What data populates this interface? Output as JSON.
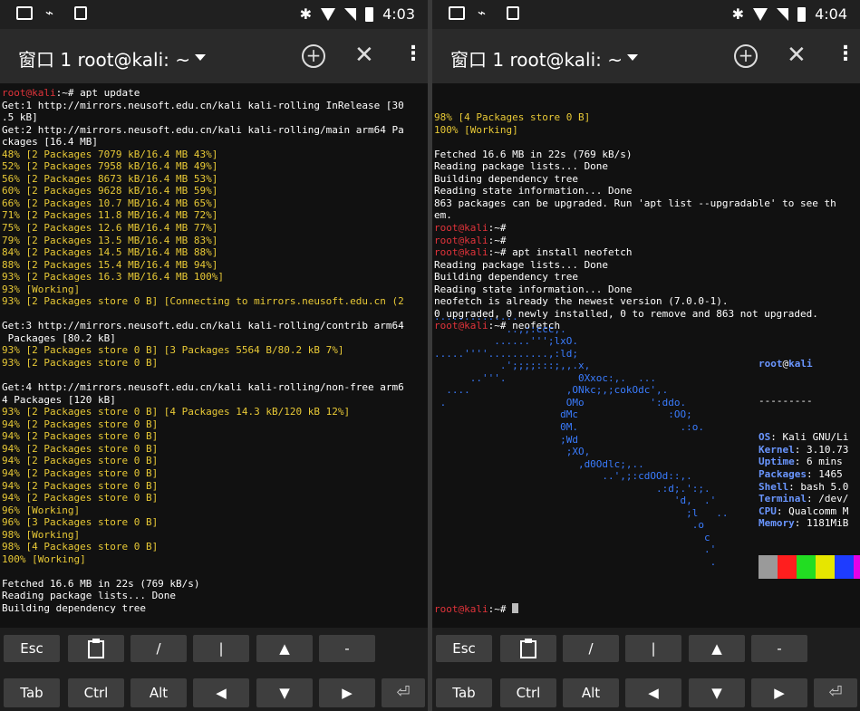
{
  "left": {
    "status": {
      "time": "4:03"
    },
    "appbar": {
      "title": "窗口 1 root@kali: ~"
    },
    "lines": [
      [
        {
          "t": "root@kali",
          "c": "r"
        },
        {
          "t": ":~# apt update"
        }
      ],
      [
        {
          "t": "Get:1 http://mirrors.neusoft.edu.cn/kali kali-rolling InRelease [30"
        }
      ],
      [
        {
          "t": ".5 kB]"
        }
      ],
      [
        {
          "t": "Get:2 http://mirrors.neusoft.edu.cn/kali kali-rolling/main arm64 Pa"
        }
      ],
      [
        {
          "t": "ckages [16.4 MB]"
        }
      ],
      [
        {
          "t": "48% [2 Packages 7079 kB/16.4 MB 43%]",
          "c": "y"
        }
      ],
      [
        {
          "t": "52% [2 Packages 7958 kB/16.4 MB 49%]",
          "c": "y"
        }
      ],
      [
        {
          "t": "56% [2 Packages 8673 kB/16.4 MB 53%]",
          "c": "y"
        }
      ],
      [
        {
          "t": "60% [2 Packages 9628 kB/16.4 MB 59%]",
          "c": "y"
        }
      ],
      [
        {
          "t": "66% [2 Packages 10.7 MB/16.4 MB 65%]",
          "c": "y"
        }
      ],
      [
        {
          "t": "71% [2 Packages 11.8 MB/16.4 MB 72%]",
          "c": "y"
        }
      ],
      [
        {
          "t": "75% [2 Packages 12.6 MB/16.4 MB 77%]",
          "c": "y"
        }
      ],
      [
        {
          "t": "79% [2 Packages 13.5 MB/16.4 MB 83%]",
          "c": "y"
        }
      ],
      [
        {
          "t": "84% [2 Packages 14.5 MB/16.4 MB 88%]",
          "c": "y"
        }
      ],
      [
        {
          "t": "88% [2 Packages 15.4 MB/16.4 MB 94%]",
          "c": "y"
        }
      ],
      [
        {
          "t": "93% [2 Packages 16.3 MB/16.4 MB 100%]",
          "c": "y"
        }
      ],
      [
        {
          "t": "93% [Working]",
          "c": "y"
        }
      ],
      [
        {
          "t": "93% [2 Packages store 0 B] [Connecting to mirrors.neusoft.edu.cn (2",
          "c": "y"
        }
      ],
      [
        {
          "t": ""
        }
      ],
      [
        {
          "t": "Get:3 http://mirrors.neusoft.edu.cn/kali kali-rolling/contrib arm64"
        }
      ],
      [
        {
          "t": " Packages [80.2 kB]"
        }
      ],
      [
        {
          "t": "93% [2 Packages store 0 B] [3 Packages 5564 B/80.2 kB 7%]",
          "c": "y"
        }
      ],
      [
        {
          "t": "93% [2 Packages store 0 B]",
          "c": "y"
        }
      ],
      [
        {
          "t": ""
        }
      ],
      [
        {
          "t": "Get:4 http://mirrors.neusoft.edu.cn/kali kali-rolling/non-free arm6"
        }
      ],
      [
        {
          "t": "4 Packages [120 kB]"
        }
      ],
      [
        {
          "t": "93% [2 Packages store 0 B] [4 Packages 14.3 kB/120 kB 12%]",
          "c": "y"
        }
      ],
      [
        {
          "t": "94% [2 Packages store 0 B]",
          "c": "y"
        }
      ],
      [
        {
          "t": "94% [2 Packages store 0 B]",
          "c": "y"
        }
      ],
      [
        {
          "t": "94% [2 Packages store 0 B]",
          "c": "y"
        }
      ],
      [
        {
          "t": "94% [2 Packages store 0 B]",
          "c": "y"
        }
      ],
      [
        {
          "t": "94% [2 Packages store 0 B]",
          "c": "y"
        }
      ],
      [
        {
          "t": "94% [2 Packages store 0 B]",
          "c": "y"
        }
      ],
      [
        {
          "t": "94% [2 Packages store 0 B]",
          "c": "y"
        }
      ],
      [
        {
          "t": "96% [Working]",
          "c": "y"
        }
      ],
      [
        {
          "t": "96% [3 Packages store 0 B]",
          "c": "y"
        }
      ],
      [
        {
          "t": "98% [Working]",
          "c": "y"
        }
      ],
      [
        {
          "t": "98% [4 Packages store 0 B]",
          "c": "y"
        }
      ],
      [
        {
          "t": "100% [Working]",
          "c": "y"
        }
      ],
      [
        {
          "t": ""
        }
      ],
      [
        {
          "t": "Fetched 16.6 MB in 22s (769 kB/s)"
        }
      ],
      [
        {
          "t": "Reading package lists... Done"
        }
      ],
      [
        {
          "t": "Building dependency tree"
        }
      ]
    ]
  },
  "right": {
    "status": {
      "time": "4:04"
    },
    "appbar": {
      "title": "窗口 1 root@kali: ~"
    },
    "lines": [
      [
        {
          "t": "98% [4 Packages store 0 B]",
          "c": "y"
        }
      ],
      [
        {
          "t": "100% [Working]",
          "c": "y"
        }
      ],
      [
        {
          "t": ""
        }
      ],
      [
        {
          "t": "Fetched 16.6 MB in 22s (769 kB/s)"
        }
      ],
      [
        {
          "t": "Reading package lists... Done"
        }
      ],
      [
        {
          "t": "Building dependency tree"
        }
      ],
      [
        {
          "t": "Reading state information... Done"
        }
      ],
      [
        {
          "t": "863 packages can be upgraded. Run 'apt list --upgradable' to see th"
        }
      ],
      [
        {
          "t": "em."
        }
      ],
      [
        {
          "t": "root@kali",
          "c": "r"
        },
        {
          "t": ":~#"
        }
      ],
      [
        {
          "t": "root@kali",
          "c": "r"
        },
        {
          "t": ":~#"
        }
      ],
      [
        {
          "t": "root@kali",
          "c": "r"
        },
        {
          "t": ":~# apt install neofetch"
        }
      ],
      [
        {
          "t": "Reading package lists... Done"
        }
      ],
      [
        {
          "t": "Building dependency tree"
        }
      ],
      [
        {
          "t": "Reading state information... Done"
        }
      ],
      [
        {
          "t": "neofetch is already the newest version (7.0.0-1)."
        }
      ],
      [
        {
          "t": "0 upgraded, 0 newly installed, 0 to remove and 863 not upgraded."
        }
      ],
      [
        {
          "t": "root@kali",
          "c": "r"
        },
        {
          "t": ":~# neofetch"
        }
      ]
    ],
    "neofetch_art": [
      "..............",
      "            ..,;:ccc,.",
      "          ......''';lxO.",
      ".....''''..........,:ld;",
      "           .';;;;:::;,,.x,",
      "      ..'''.            0Xxoc:,.  ...",
      "  ....                ,ONkc;,;cokOdc',.",
      " .                    OMo           ':ddo.",
      "                     dMc               :OO;",
      "                     0M.                 .:o.",
      "                     ;Wd",
      "                      ;XO,",
      "                        ,d0Odlc;,..",
      "                            ..',;:cdOOd::,.",
      "                                     .:d;.':;.",
      "                                        'd,  .'",
      "                                          ;l   ..",
      "                                           .o",
      "                                             c",
      "                                             .'",
      "                                              ."
    ],
    "neofetch_info": {
      "user": "root",
      "at": "@",
      "host": "kali",
      "separator": "---------",
      "rows": [
        {
          "k": "OS",
          "v": "Kali GNU/Li"
        },
        {
          "k": "Kernel",
          "v": "3.10.73"
        },
        {
          "k": "Uptime",
          "v": "6 mins"
        },
        {
          "k": "Packages",
          "v": "1465"
        },
        {
          "k": "Shell",
          "v": "bash 5.0"
        },
        {
          "k": "Terminal",
          "v": "/dev/"
        },
        {
          "k": "CPU",
          "v": "Qualcomm M"
        },
        {
          "k": "Memory",
          "v": "1181MiB"
        }
      ]
    },
    "swatch_colors": [
      "#9a9a9a",
      "#ff1e1e",
      "#22dd22",
      "#e6e600",
      "#1e3cff",
      "#e600e6",
      "#00e6e6",
      "#ffffff"
    ],
    "prompt_last": [
      {
        "t": "root@kali",
        "c": "r"
      },
      {
        "t": ":~# "
      }
    ]
  },
  "extra_keys": {
    "row1": [
      "Esc",
      "clipboard",
      "/",
      "|",
      "▲",
      "-"
    ],
    "row2": [
      "Tab",
      "Ctrl",
      "Alt",
      "◀",
      "▼",
      "▶",
      "return"
    ]
  }
}
